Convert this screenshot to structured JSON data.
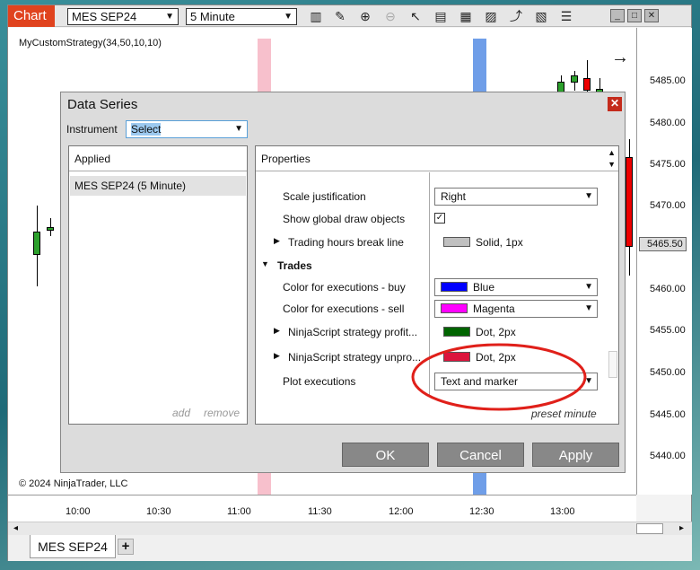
{
  "window": {
    "tab_label": "Chart",
    "instrument": "MES SEP24",
    "interval": "5 Minute",
    "controls": [
      "minimize",
      "maximize",
      "close"
    ]
  },
  "toolbar": {
    "icons": [
      "bar-chart-icon",
      "pencil-icon",
      "zoom-in-icon",
      "zoom-out-icon",
      "pointer-icon",
      "data-box-icon",
      "series-icon",
      "indicators-icon",
      "strategy-icon",
      "properties-icon",
      "list-icon"
    ]
  },
  "chart": {
    "strategy_label": "MyCustomStrategy(34,50,10,10)",
    "copyright": "© 2024 NinjaTrader, LLC",
    "price_labels": [
      "5485.00",
      "5480.00",
      "5475.00",
      "5470.00",
      "5465.50",
      "5460.00",
      "5455.00",
      "5450.00",
      "5445.00",
      "5440.00"
    ],
    "current_price": "5465.50",
    "time_labels": [
      "10:00",
      "10:30",
      "11:00",
      "11:30",
      "12:00",
      "12:30",
      "13:00"
    ],
    "highlight_colors": {
      "pink": "#f7c0cc",
      "blue": "#6f9ee8"
    }
  },
  "bottom": {
    "tab_label": "MES SEP24",
    "add_tab": "+"
  },
  "dialog": {
    "title": "Data Series",
    "instrument_label": "Instrument",
    "instrument_value": "Select",
    "applied_header": "Applied",
    "applied_item": "MES SEP24 (5 Minute)",
    "add_label": "add",
    "remove_label": "remove",
    "properties_header": "Properties",
    "rows": {
      "scale_justification": {
        "label": "Scale justification",
        "value": "Right"
      },
      "show_global": {
        "label": "Show global draw objects",
        "checked": true
      },
      "trading_hours": {
        "label": "Trading hours break line",
        "value": "Solid, 1px",
        "color": "#c0c0c0"
      },
      "trades_section": "Trades",
      "exec_buy": {
        "label": "Color for executions - buy",
        "value": "Blue",
        "color": "#0000ff"
      },
      "exec_sell": {
        "label": "Color for executions - sell",
        "value": "Magenta",
        "color": "#ff00ff"
      },
      "strategy_profit": {
        "label": "NinjaScript strategy profit...",
        "value": "Dot, 2px",
        "color": "#006400"
      },
      "strategy_unpro": {
        "label": "NinjaScript strategy unpro...",
        "value": "Dot, 2px",
        "color": "#dc143c"
      },
      "plot_executions": {
        "label": "Plot executions",
        "value": "Text and marker"
      }
    },
    "preset_label": "preset minute",
    "buttons": {
      "ok": "OK",
      "cancel": "Cancel",
      "apply": "Apply"
    }
  }
}
